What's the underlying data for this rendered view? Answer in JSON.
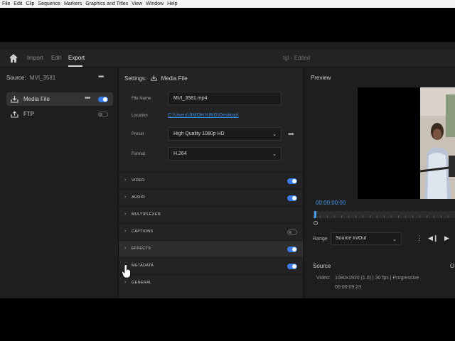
{
  "menubar": {
    "items": [
      "File",
      "Edit",
      "Clip",
      "Sequence",
      "Markers",
      "Graphics and Titles",
      "View",
      "Window",
      "Help"
    ]
  },
  "appbar": {
    "tabs": [
      "Import",
      "Edit",
      "Export"
    ],
    "active_tab": "Export",
    "project_name": "tgl",
    "project_status": "- Edited"
  },
  "source_panel": {
    "label": "Source:",
    "name": "MVI_3581",
    "destinations": [
      {
        "label": "Media File",
        "enabled": true,
        "selected": true,
        "icon": "export-icon"
      },
      {
        "label": "FTP",
        "enabled": false,
        "selected": false,
        "icon": "upload-icon"
      }
    ]
  },
  "settings": {
    "label": "Settings:",
    "destination": "Media File",
    "file_name_label": "File Name",
    "file_name": "MVI_3581.mp4",
    "location_label": "Location",
    "location": "C:\\Users\\JIMOH KING\\Desktop\\",
    "preset_label": "Preset",
    "preset": "High Quality 1080p HD",
    "format_label": "Format",
    "format": "H.264",
    "sections": [
      {
        "label": "VIDEO",
        "toggle": "on"
      },
      {
        "label": "AUDIO",
        "toggle": "on"
      },
      {
        "label": "MULTIPLEXER",
        "toggle": "none"
      },
      {
        "label": "CAPTIONS",
        "toggle": "off"
      },
      {
        "label": "EFFECTS",
        "toggle": "on"
      },
      {
        "label": "METADATA",
        "toggle": "on"
      },
      {
        "label": "GENERAL",
        "toggle": "none"
      }
    ]
  },
  "preview": {
    "title": "Preview",
    "timecode": "00:00:00:00",
    "range_label": "Range",
    "range_value": "Source In/Out",
    "source_title": "Source",
    "source_trailing": "O",
    "video_label": "Video:",
    "video_info": "1080x1920 (1.0)  |  30 fps  |  Progressive",
    "video_duration": "00:00:09:23"
  },
  "colors": {
    "accent": "#3b7be6",
    "timecode": "#4a9bf0",
    "link": "#3b8fe0"
  }
}
